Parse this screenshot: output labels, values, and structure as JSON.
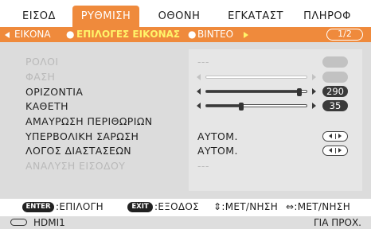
{
  "tabs": [
    {
      "label": "ΕΙΣΟΔ",
      "active": false
    },
    {
      "label": "ΡΥΘΜΙΣΗ",
      "active": true
    },
    {
      "label": "ΟΘΟΝΗ",
      "active": false
    },
    {
      "label": "ΕΓΚΑΤΑΣΤ",
      "active": false
    },
    {
      "label": "ΠΛΗΡΟΦ",
      "active": false
    }
  ],
  "subtabs": {
    "items": [
      "ΕΙΚΟΝΑ",
      "ΕΠΙΛΟΓΕΣ ΕΙΚΟΝΑΣ",
      "ΒΙΝΤΕΟ"
    ],
    "active": "ΕΠΙΛΟΓΕΣ ΕΙΚΟΝΑΣ",
    "page": "1/2"
  },
  "settings": [
    {
      "label": "ΡΟΛΟΙ",
      "enabled": false,
      "value": "---"
    },
    {
      "label": "ΦΑΣΗ",
      "enabled": false,
      "slider_level": 1.0
    },
    {
      "label": "ΟΡΙΖΟΝΤΙΑ",
      "enabled": true,
      "slider_level": 0.93,
      "value": "290"
    },
    {
      "label": "ΚΑΘΕΤΗ",
      "enabled": true,
      "slider_level": 0.35,
      "value": "35"
    },
    {
      "label": "ΑΜΑΥΡΩΣΗ ΠΕΡΙΘΩΡΙΩΝ",
      "enabled": true
    },
    {
      "label": "ΥΠΕΡΒΟΛΙΚΗ ΣΑΡΩΣΗ",
      "enabled": true,
      "value": "ΑΥΤΟΜ."
    },
    {
      "label": "ΛΟΓΟΣ ΔΙΑΣΤΑΣΕΩΝ",
      "enabled": true,
      "value": "ΑΥΤΟΜ."
    },
    {
      "label": "ΑΝΑΛΥΣΗ ΕΙΣΟΔΟΥ",
      "enabled": false,
      "value": "---"
    }
  ],
  "help": {
    "enter_key": "ENTER",
    "enter_text": ":ΕΠΙΛΟΓΗ",
    "exit_key": "EXIT",
    "exit_text": ":ΕΞΟΔΟΣ",
    "move_vertical": "⇕:ΜΕΤ/ΝΗΣΗ",
    "move_horizontal": "⇔:ΜΕΤ/ΝΗΣΗ"
  },
  "status": {
    "source": "HDMI1",
    "mode": "ΓΙΑ ΠΡΟΧ."
  },
  "colors": {
    "accent": "#ef8a3c",
    "highlight_text": "#fff46a"
  }
}
